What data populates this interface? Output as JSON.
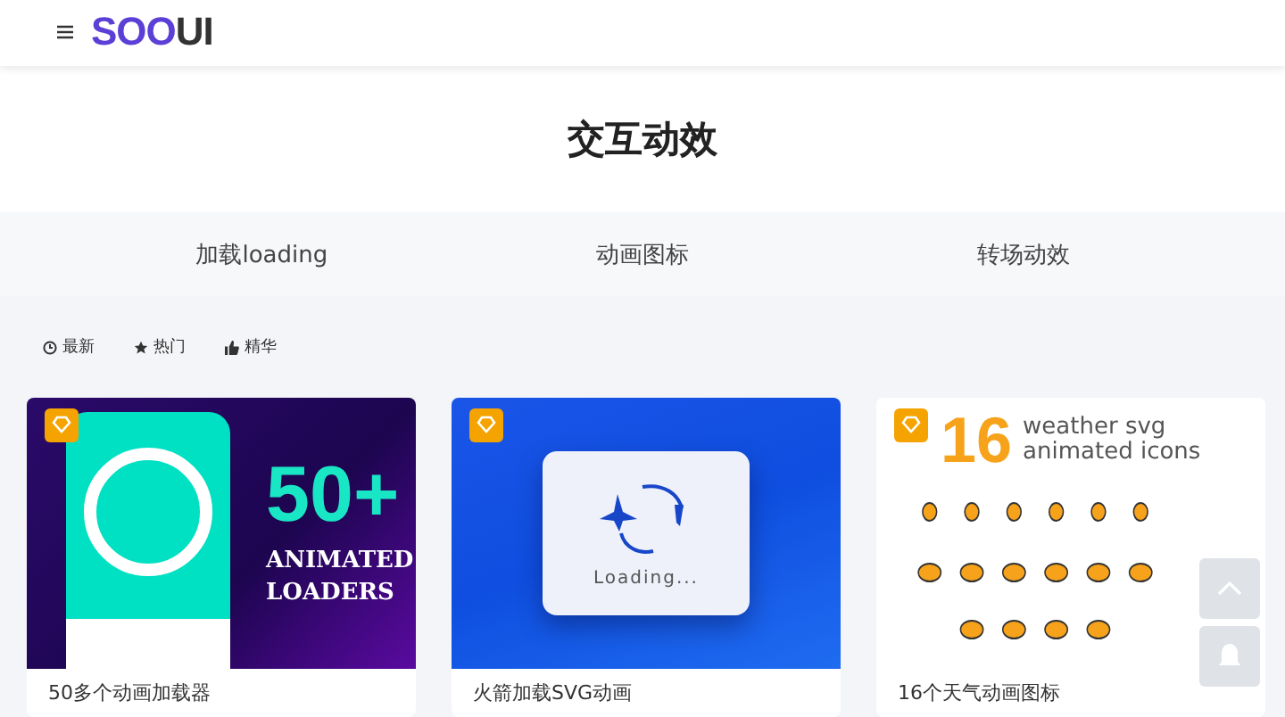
{
  "header": {
    "logo": {
      "part_1": "SOO",
      "part_2": "UI"
    }
  },
  "page_title": "交互动效",
  "tabs": [
    {
      "label": "加载loading",
      "selected": false
    },
    {
      "label": "动画图标",
      "selected": false
    },
    {
      "label": "转场动效",
      "selected": false
    }
  ],
  "filters": [
    {
      "kind": "latest",
      "label": "最新"
    },
    {
      "kind": "hot",
      "label": "热门"
    },
    {
      "kind": "best",
      "label": "精华"
    }
  ],
  "cards": [
    {
      "kind": "loaders",
      "title": "50多个动画加载器",
      "art_text": [
        "50+",
        "ANIMATED",
        "LOADERS"
      ]
    },
    {
      "kind": "rocket",
      "title": "火箭加载SVG动画",
      "art_text": [
        "Loading..."
      ]
    },
    {
      "kind": "weather",
      "title": "16个天气动画图标",
      "art_text": [
        "16",
        "weather svg",
        "animated icons"
      ]
    }
  ]
}
